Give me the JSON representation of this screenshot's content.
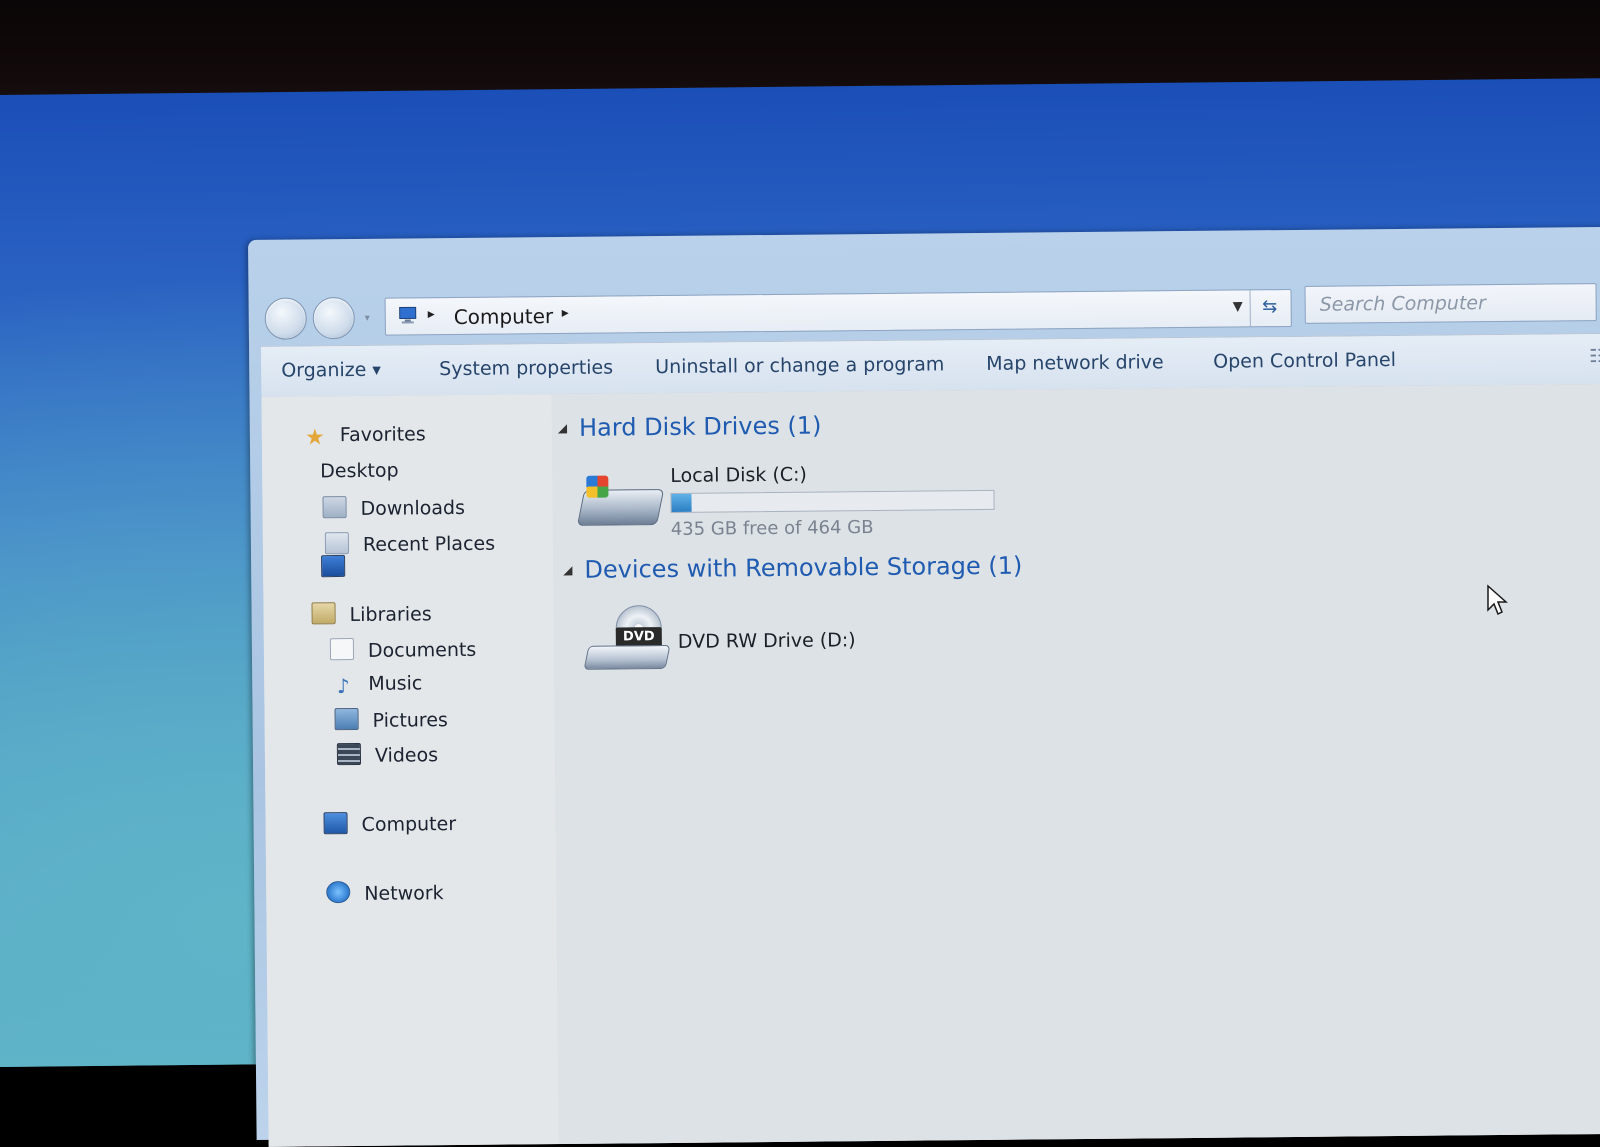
{
  "window": {
    "address": {
      "location": "Computer"
    },
    "search": {
      "placeholder": "Search Computer"
    }
  },
  "toolbar": {
    "organize": "Organize",
    "system_properties": "System properties",
    "uninstall": "Uninstall or change a program",
    "map_drive": "Map network drive",
    "control_panel": "Open Control Panel"
  },
  "sidebar": {
    "favorites": "Favorites",
    "desktop": "Desktop",
    "downloads": "Downloads",
    "recent": "Recent Places",
    "libraries": "Libraries",
    "documents": "Documents",
    "music": "Music",
    "pictures": "Pictures",
    "videos": "Videos",
    "computer": "Computer",
    "network": "Network"
  },
  "content": {
    "hdd_group": "Hard Disk Drives (1)",
    "removable_group": "Devices with Removable Storage (1)",
    "local_disk": {
      "name": "Local Disk (C:)",
      "free_text": "435 GB free of 464 GB",
      "used_fraction": 0.0625
    },
    "dvd": {
      "name": "DVD RW Drive (D:)",
      "label": "DVD"
    }
  },
  "colors": {
    "link_blue": "#1f5bb0",
    "toolbar_text": "#27456b",
    "usage_fill": "#2b7fc3"
  }
}
